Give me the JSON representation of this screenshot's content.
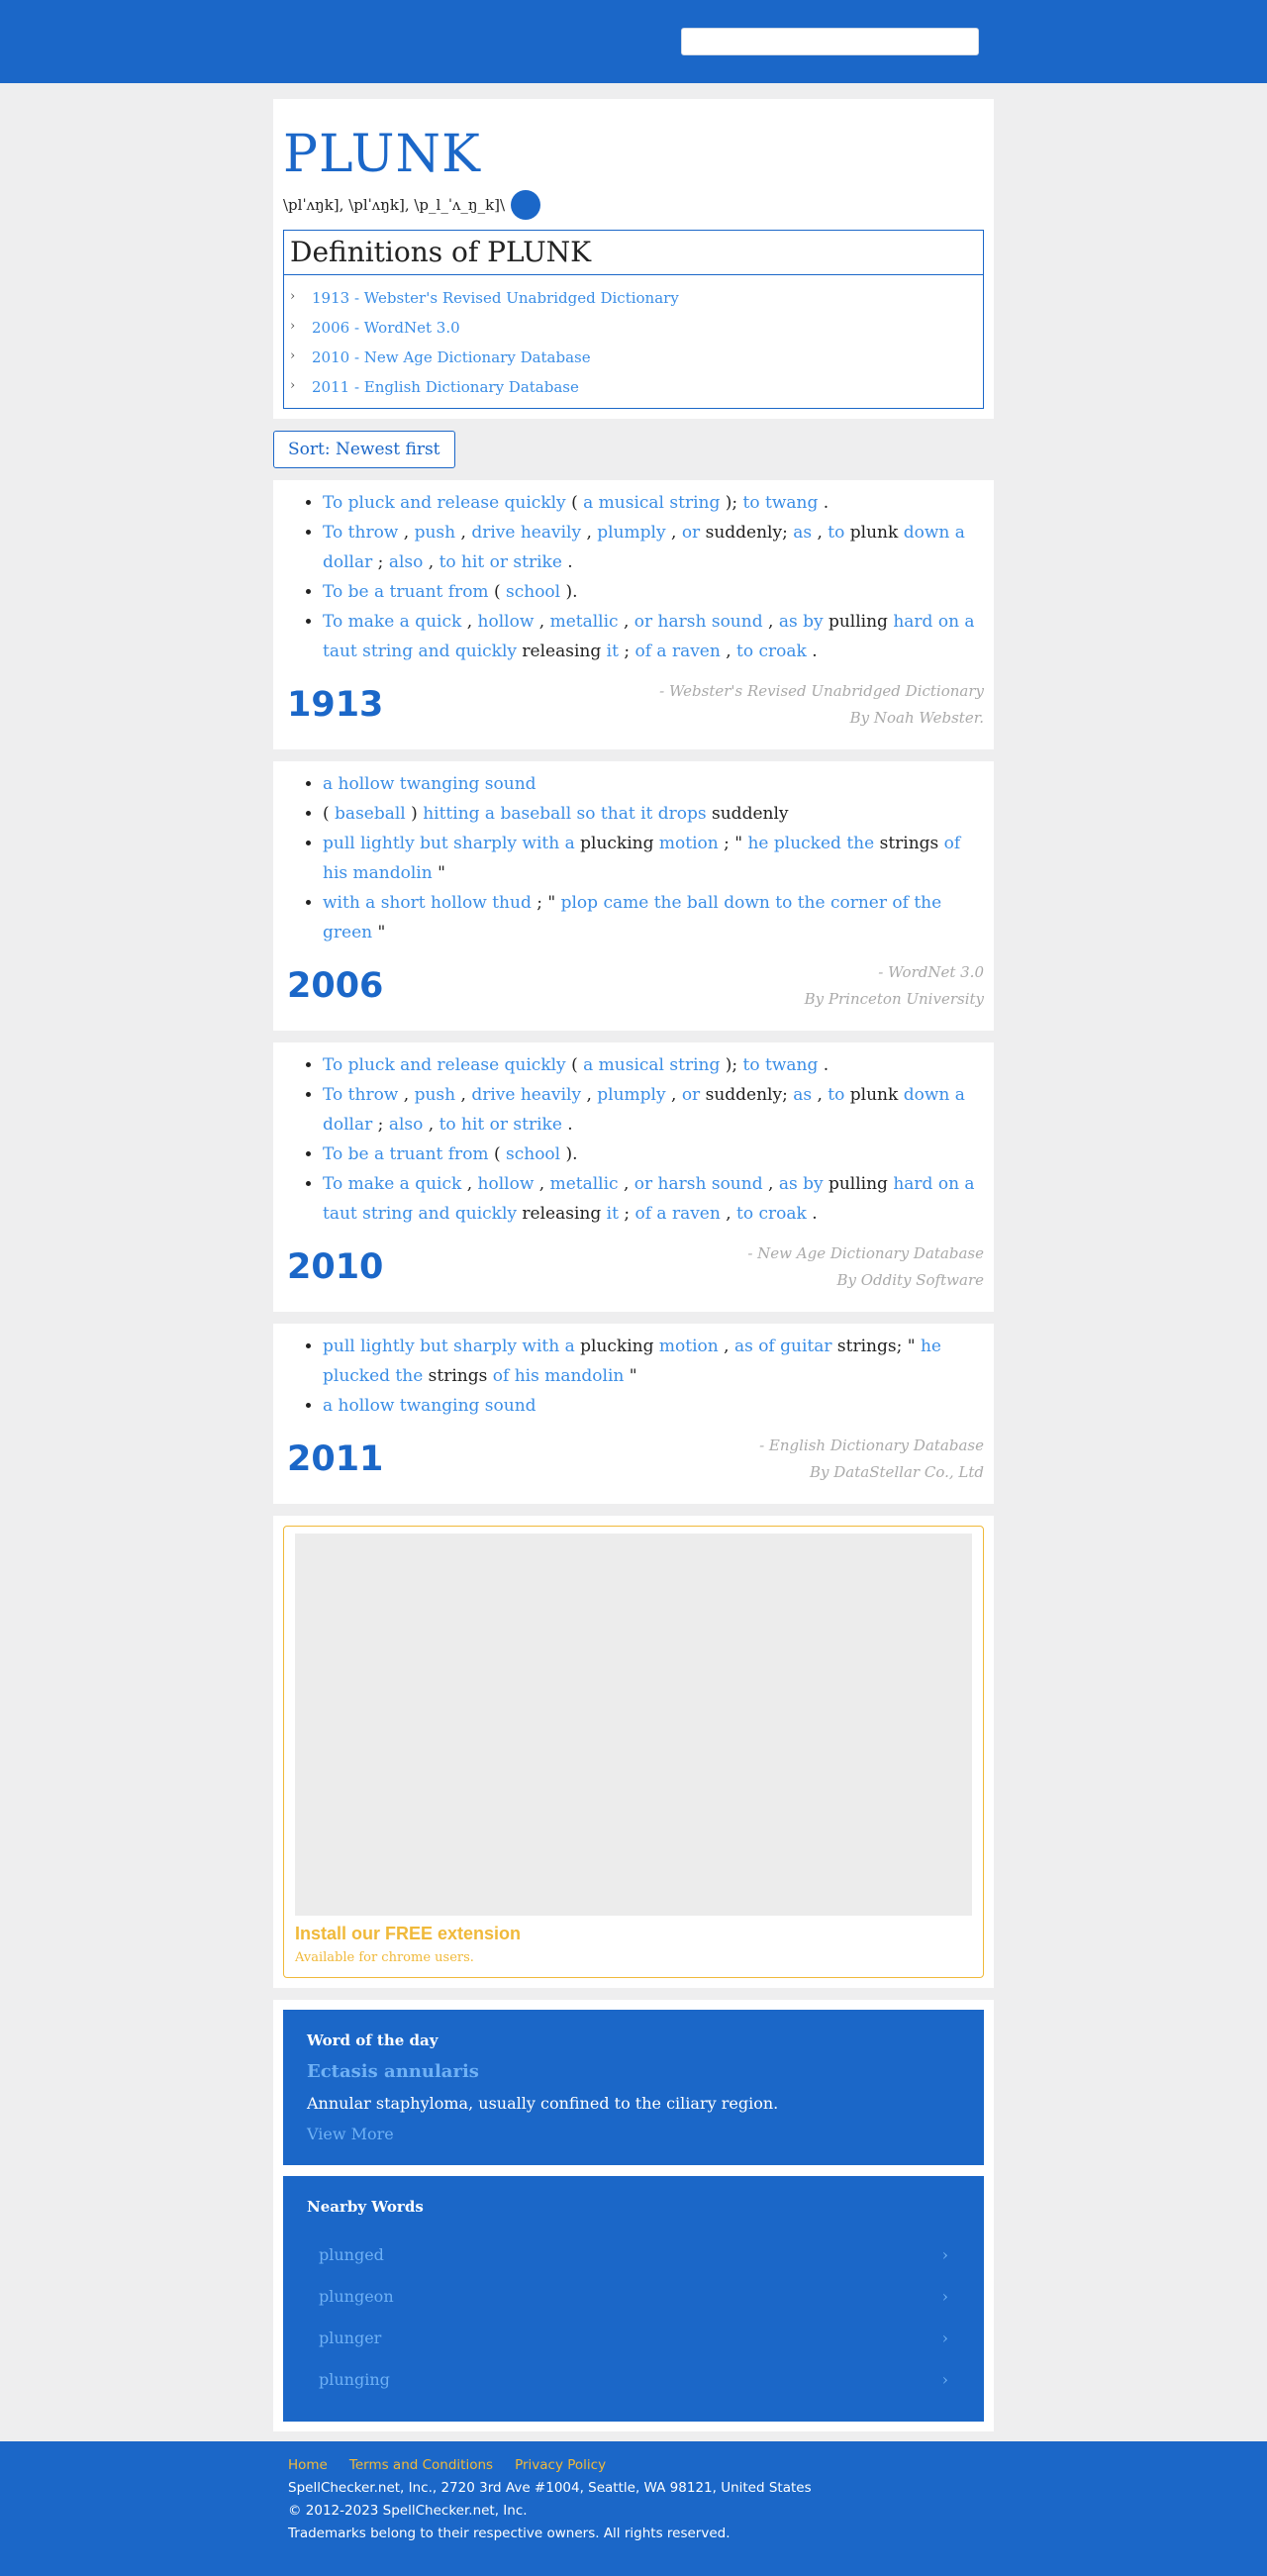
{
  "header": {
    "search_placeholder": ""
  },
  "word": "PLUNK",
  "pronunciation": "\\plˈʌŋk], \\plˈʌŋk], \\p_l_ˈʌ_ŋ_k]\\",
  "definitions_title": "Definitions of PLUNK",
  "sources": [
    "1913 - Webster's Revised Unabridged Dictionary",
    "2006 - WordNet 3.0",
    "2010 - New Age Dictionary Database",
    "2011 - English Dictionary Database"
  ],
  "sort_label": "Sort: Newest first",
  "entries": [
    {
      "year": "1913",
      "source": "- Webster's Revised Unabridged Dictionary",
      "author": "By Noah Webster.",
      "defs": [
        [
          [
            "To pluck and release quickly",
            true
          ],
          [
            " ( ",
            false
          ],
          [
            "a musical string",
            true
          ],
          [
            " ); ",
            false
          ],
          [
            "to twang",
            true
          ],
          [
            " .",
            false
          ]
        ],
        [
          [
            "To throw",
            true
          ],
          [
            " , ",
            false
          ],
          [
            "push",
            true
          ],
          [
            " , ",
            false
          ],
          [
            "drive heavily",
            true
          ],
          [
            " , ",
            false
          ],
          [
            "plumply",
            true
          ],
          [
            " , ",
            false
          ],
          [
            "or",
            true
          ],
          [
            " suddenly; ",
            false
          ],
          [
            "as",
            true
          ],
          [
            " , ",
            false
          ],
          [
            "to",
            true
          ],
          [
            " plunk ",
            false
          ],
          [
            "down a dollar",
            true
          ],
          [
            " ; ",
            false
          ],
          [
            "also",
            true
          ],
          [
            " , ",
            false
          ],
          [
            "to hit or strike",
            true
          ],
          [
            " .",
            false
          ]
        ],
        [
          [
            "To be a truant from",
            true
          ],
          [
            " ( ",
            false
          ],
          [
            "school",
            true
          ],
          [
            " ).",
            false
          ]
        ],
        [
          [
            "To make a quick",
            true
          ],
          [
            " , ",
            false
          ],
          [
            "hollow",
            true
          ],
          [
            " , ",
            false
          ],
          [
            "metallic",
            true
          ],
          [
            " , ",
            false
          ],
          [
            "or harsh sound",
            true
          ],
          [
            " , ",
            false
          ],
          [
            "as by",
            true
          ],
          [
            " pulling ",
            false
          ],
          [
            "hard on a taut string and quickly",
            true
          ],
          [
            " releasing ",
            false
          ],
          [
            "it",
            true
          ],
          [
            " ; ",
            false
          ],
          [
            "of a raven",
            true
          ],
          [
            " , ",
            false
          ],
          [
            "to croak",
            true
          ],
          [
            " .",
            false
          ]
        ]
      ]
    },
    {
      "year": "2006",
      "source": "- WordNet 3.0",
      "author": "By Princeton University",
      "defs": [
        [
          [
            "a hollow twanging sound",
            true
          ]
        ],
        [
          [
            "( ",
            false
          ],
          [
            "baseball",
            true
          ],
          [
            " ) ",
            false
          ],
          [
            "hitting a baseball so that it drops",
            true
          ],
          [
            " suddenly",
            false
          ]
        ],
        [
          [
            "pull lightly but sharply with a",
            true
          ],
          [
            " plucking ",
            false
          ],
          [
            "motion",
            true
          ],
          [
            " ; \" ",
            false
          ],
          [
            "he plucked the",
            true
          ],
          [
            " strings ",
            false
          ],
          [
            "of his mandolin",
            true
          ],
          [
            " \"",
            false
          ]
        ],
        [
          [
            "with a short hollow thud",
            true
          ],
          [
            " ; \" ",
            false
          ],
          [
            "plop came the ball down to the corner of the green",
            true
          ],
          [
            " \"",
            false
          ]
        ]
      ]
    },
    {
      "year": "2010",
      "source": "- New Age Dictionary Database",
      "author": "By Oddity Software",
      "defs": [
        [
          [
            "To pluck and release quickly",
            true
          ],
          [
            " ( ",
            false
          ],
          [
            "a musical string",
            true
          ],
          [
            " ); ",
            false
          ],
          [
            "to twang",
            true
          ],
          [
            " .",
            false
          ]
        ],
        [
          [
            "To throw",
            true
          ],
          [
            " , ",
            false
          ],
          [
            "push",
            true
          ],
          [
            " , ",
            false
          ],
          [
            "drive heavily",
            true
          ],
          [
            " , ",
            false
          ],
          [
            "plumply",
            true
          ],
          [
            " , ",
            false
          ],
          [
            "or",
            true
          ],
          [
            " suddenly; ",
            false
          ],
          [
            "as",
            true
          ],
          [
            " , ",
            false
          ],
          [
            "to",
            true
          ],
          [
            " plunk ",
            false
          ],
          [
            "down a dollar",
            true
          ],
          [
            " ; ",
            false
          ],
          [
            "also",
            true
          ],
          [
            " , ",
            false
          ],
          [
            "to hit or strike",
            true
          ],
          [
            " .",
            false
          ]
        ],
        [
          [
            "To be a truant from",
            true
          ],
          [
            " ( ",
            false
          ],
          [
            "school",
            true
          ],
          [
            " ).",
            false
          ]
        ],
        [
          [
            "To make a quick",
            true
          ],
          [
            " , ",
            false
          ],
          [
            "hollow",
            true
          ],
          [
            " , ",
            false
          ],
          [
            "metallic",
            true
          ],
          [
            " , ",
            false
          ],
          [
            "or harsh sound",
            true
          ],
          [
            " , ",
            false
          ],
          [
            "as by",
            true
          ],
          [
            " pulling ",
            false
          ],
          [
            "hard on a taut string and quickly",
            true
          ],
          [
            " releasing ",
            false
          ],
          [
            "it",
            true
          ],
          [
            " ; ",
            false
          ],
          [
            "of a raven",
            true
          ],
          [
            " , ",
            false
          ],
          [
            "to croak",
            true
          ],
          [
            " .",
            false
          ]
        ]
      ]
    },
    {
      "year": "2011",
      "source": "- English Dictionary Database",
      "author": "By DataStellar Co., Ltd",
      "defs": [
        [
          [
            "pull lightly but sharply with a",
            true
          ],
          [
            " plucking ",
            false
          ],
          [
            "motion",
            true
          ],
          [
            " , ",
            false
          ],
          [
            "as of guitar",
            true
          ],
          [
            " strings; \" ",
            false
          ],
          [
            "he plucked the",
            true
          ],
          [
            " strings ",
            false
          ],
          [
            "of his mandolin",
            true
          ],
          [
            " \"",
            false
          ]
        ],
        [
          [
            "a hollow twanging sound",
            true
          ]
        ]
      ]
    }
  ],
  "extension": {
    "title": "Install our FREE extension",
    "subtitle": "Available for chrome users."
  },
  "word_of_day": {
    "label": "Word of the day",
    "word": "Ectasis annularis",
    "definition": "Annular staphyloma, usually confined to the ciliary region.",
    "more": "View More"
  },
  "nearby": {
    "label": "Nearby Words",
    "words": [
      "plunged",
      "plungeon",
      "plunger",
      "plunging"
    ],
    "arrow": "›"
  },
  "footer": {
    "links": [
      "Home",
      "Terms and Conditions",
      "Privacy Policy"
    ],
    "address": "SpellChecker.net, Inc., 2720 3rd Ave #1004, Seattle, WA 98121, United States",
    "copyright": "© 2012-2023 SpellChecker.net, Inc.",
    "trademarks": "Trademarks belong to their respective owners. All rights reserved."
  },
  "colors": {
    "brand": "#1b67c8",
    "link": "#3b8ee6",
    "accent": "#f0b93a"
  }
}
